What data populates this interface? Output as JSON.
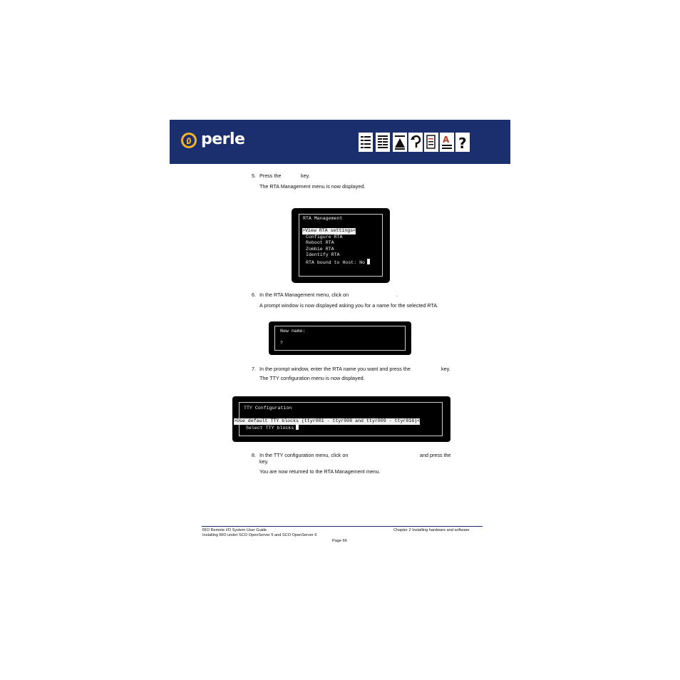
{
  "header": {
    "logo_text": "perle",
    "nav_icons": [
      "contents-icon",
      "index-icon",
      "top-icon",
      "back-icon",
      "chapter-icon",
      "glossary-icon",
      "help-icon"
    ],
    "colors": {
      "banner": "#1b2f6e",
      "logo_accent": "#f0b429"
    }
  },
  "steps": [
    {
      "number": "5.",
      "text_a": "Press the",
      "text_b": "key.",
      "note": "The RTA Management menu is now displayed."
    },
    {
      "number": "6.",
      "text_a": "In the RTA Management menu, click on",
      "text_b": ".",
      "note": "A prompt window is now displayed asking you for a name for the selected RTA."
    },
    {
      "number": "7.",
      "text_a": "In the prompt window, enter the RTA name you want and press the",
      "text_b": "key.",
      "note": "The TTY configuration menu is now displayed."
    },
    {
      "number": "8.",
      "text_a": "In the TTY configuration menu, click on",
      "text_b": "and press the",
      "text_c": "key.",
      "note": "You are now returned to the RTA Management menu."
    }
  ],
  "screens": {
    "rta": {
      "title": "RTA Management",
      "selected": ">View RTA settings<",
      "items": [
        "Configure RTA",
        "Reboot RTA",
        "Zombie RTA",
        "Identify RTA",
        "RTA bound to Host: No"
      ]
    },
    "prompt": {
      "label": "New name:",
      "value": "?"
    },
    "tty": {
      "title": "TTY Configuration",
      "selected": ">Use default TTY blocks (ttyr001 - ttyr008 and ttyr009 - ttyr016)<",
      "item": "Select TTY blocks"
    }
  },
  "footer": {
    "left_1": "RIO Remote I/O System User Guide",
    "left_2": "Installing RIO under SCO OpenServer 5 and SCO OpenServer 6",
    "right": "Chapter 2 Installing hardware and software",
    "page": "Page 66"
  }
}
